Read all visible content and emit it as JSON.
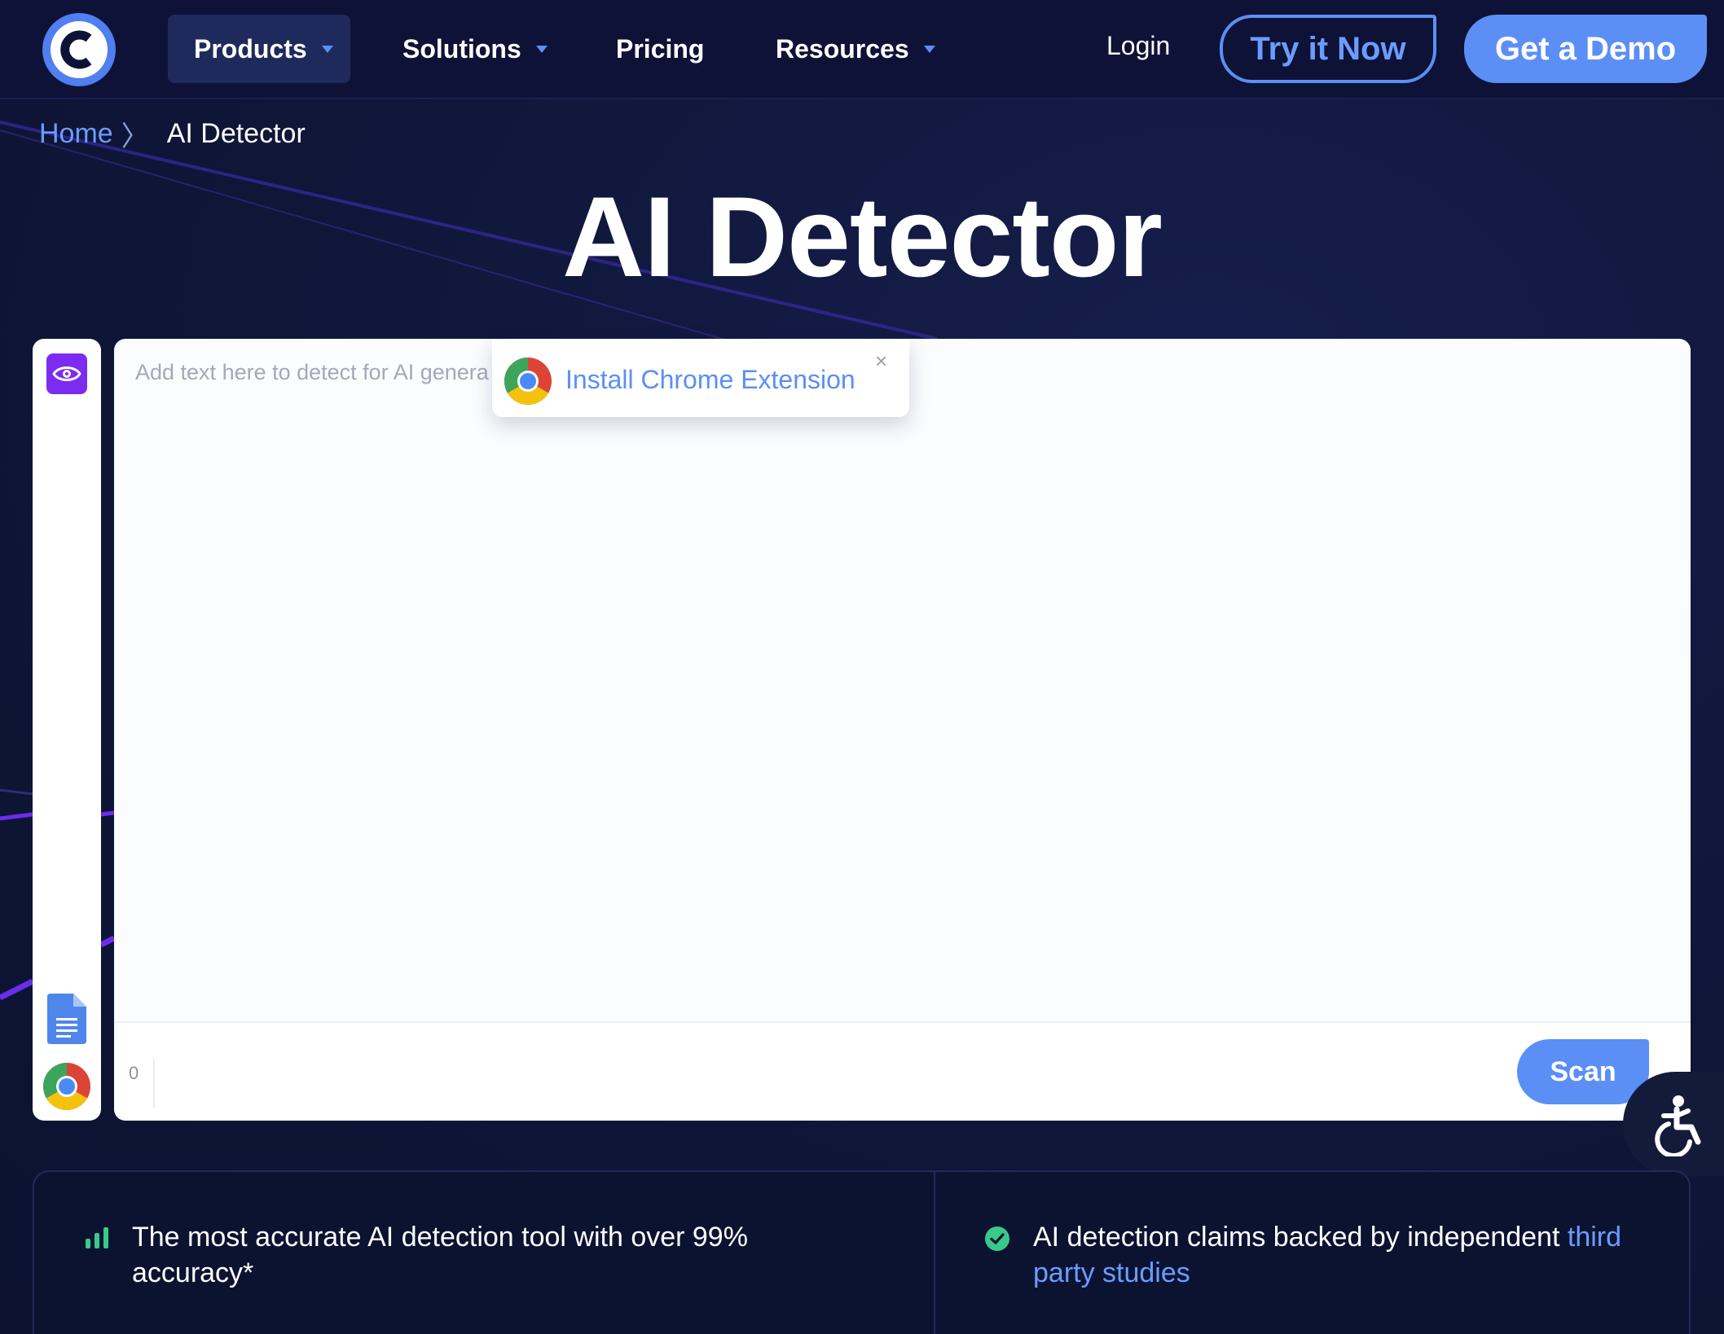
{
  "nav": {
    "products": "Products",
    "solutions": "Solutions",
    "pricing": "Pricing",
    "resources": "Resources",
    "login": "Login",
    "try_now": "Try it Now",
    "get_demo": "Get a Demo"
  },
  "breadcrumb": {
    "home": "Home",
    "separator": "〉",
    "current": "AI Detector"
  },
  "page_title": "AI Detector",
  "editor": {
    "placeholder": "Add text here to detect for AI genera",
    "word_count": "0",
    "scan_label": "Scan"
  },
  "chrome_popup": {
    "text": "Install Chrome Extension",
    "close": "×"
  },
  "features": {
    "accuracy": "The most accurate AI detection tool with over 99% accuracy*",
    "claims_prefix": "AI detection claims backed by independent ",
    "claims_link": "third party studies"
  },
  "icons": {
    "logo": "copyleaks-logo",
    "eye": "eye-icon",
    "google_docs": "google-docs-icon",
    "chrome": "chrome-icon",
    "accessibility": "accessibility-icon",
    "bars": "bar-chart-icon",
    "check": "check-circle-icon"
  },
  "colors": {
    "background": "#0f1537",
    "accent": "#5b8ff5",
    "purple": "#7b2cf0",
    "green": "#39c98a"
  }
}
